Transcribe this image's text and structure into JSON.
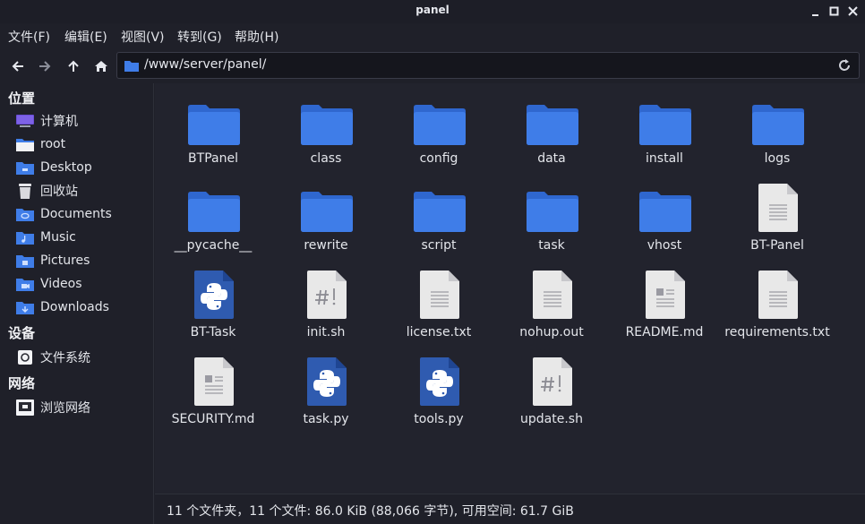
{
  "window": {
    "title": "panel"
  },
  "menu": [
    "文件(F)",
    "编辑(E)",
    "视图(V)",
    "转到(G)",
    "帮助(H)"
  ],
  "path": "/www/server/panel/",
  "sidebar": {
    "places_header": "位置",
    "places": [
      {
        "label": "计算机",
        "icon": "computer-icon"
      },
      {
        "label": "root",
        "icon": "home-folder-icon"
      },
      {
        "label": "Desktop",
        "icon": "desktop-folder-icon"
      },
      {
        "label": "回收站",
        "icon": "trash-icon"
      },
      {
        "label": "Documents",
        "icon": "documents-folder-icon"
      },
      {
        "label": "Music",
        "icon": "music-folder-icon"
      },
      {
        "label": "Pictures",
        "icon": "pictures-folder-icon"
      },
      {
        "label": "Videos",
        "icon": "videos-folder-icon"
      },
      {
        "label": "Downloads",
        "icon": "downloads-folder-icon"
      }
    ],
    "devices_header": "设备",
    "devices": [
      {
        "label": "文件系统",
        "icon": "drive-icon"
      }
    ],
    "network_header": "网络",
    "network": [
      {
        "label": "浏览网络",
        "icon": "network-icon"
      }
    ]
  },
  "files": [
    {
      "name": "BTPanel",
      "type": "folder"
    },
    {
      "name": "class",
      "type": "folder"
    },
    {
      "name": "config",
      "type": "folder"
    },
    {
      "name": "data",
      "type": "folder"
    },
    {
      "name": "install",
      "type": "folder"
    },
    {
      "name": "logs",
      "type": "folder"
    },
    {
      "name": "__pycache__",
      "type": "folder"
    },
    {
      "name": "rewrite",
      "type": "folder"
    },
    {
      "name": "script",
      "type": "folder"
    },
    {
      "name": "task",
      "type": "folder"
    },
    {
      "name": "vhost",
      "type": "folder"
    },
    {
      "name": "BT-Panel",
      "type": "text"
    },
    {
      "name": "BT-Task",
      "type": "python"
    },
    {
      "name": "init.sh",
      "type": "script"
    },
    {
      "name": "license.txt",
      "type": "text"
    },
    {
      "name": "nohup.out",
      "type": "text"
    },
    {
      "name": "README.md",
      "type": "markdown"
    },
    {
      "name": "requirements.txt",
      "type": "text"
    },
    {
      "name": "SECURITY.md",
      "type": "markdown"
    },
    {
      "name": "task.py",
      "type": "python"
    },
    {
      "name": "tools.py",
      "type": "python"
    },
    {
      "name": "update.sh",
      "type": "script"
    }
  ],
  "status": "11 个文件夹，11 个文件: 86.0 KiB (88,066 字节), 可用空间: 61.7 GiB",
  "colors": {
    "folder": "#3f7de8",
    "folder_tab": "#2f67cf",
    "doc": "#e8e8e8",
    "python": "#2f5bb0",
    "accent": "#3f7de8"
  }
}
